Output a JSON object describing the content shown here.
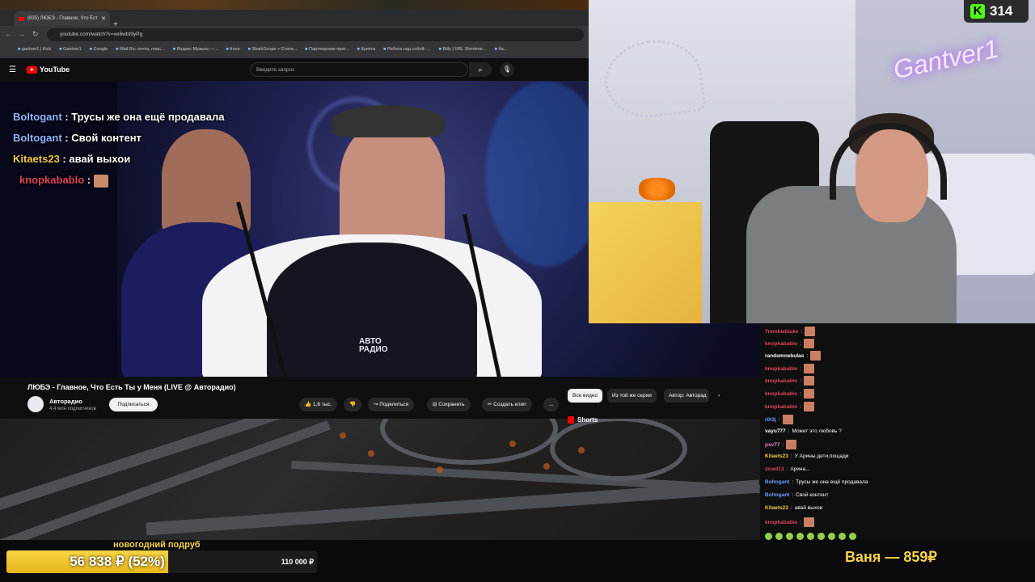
{
  "browser": {
    "tab_title": "(835) ЛЮБЭ - Главное, Что Ест",
    "url": "youtube.com/watch?v=xe6wbt9yPg",
    "bookmarks": [
      "gantver1 | Kick",
      "Gantver1",
      "Google",
      "Mail.Ru: почта, поис...",
      "Яндекс Музыка —...",
      "frovo",
      "SharkScope » Стати...",
      "Партнерские прог...",
      "Крипта",
      "Работа над собой -...",
      "Bitly | URL Shortene...",
      "Ка..."
    ],
    "search_placeholder": "Введите запрос",
    "yt_logo": "YouTube"
  },
  "overlay_chat": [
    {
      "user": "Boltogant",
      "sep": " : ",
      "text": "Трусы же она ещё продавала",
      "color": "blue"
    },
    {
      "user": "Boltogant",
      "sep": " : ",
      "text": "Свой контент",
      "color": "blue"
    },
    {
      "user": "Kitaets23",
      "sep": " : ",
      "text": "авай выхои",
      "color": "yellow"
    },
    {
      "user": "knopkabablo",
      "sep": " : ",
      "text": "",
      "color": "red"
    }
  ],
  "video": {
    "channel_logo_text": "АВТО\nРАДИО",
    "title": "ЛЮБЭ - Главное, Что Есть Ты у Меня (LIVE @ Авторадио)",
    "channel": "Авторадио",
    "subscribers": "4,4 млн подписчиков",
    "subscribe_label": "Подписаться",
    "likes": "1,6 тыс.",
    "share_label": "Поделиться",
    "save_label": "Сохранить",
    "clip_label": "Создать клип",
    "more_label": "...",
    "chips": [
      "Все видео",
      "Из той же серии",
      "Автор: Авторад"
    ],
    "shorts_label": "Shorts"
  },
  "kick": {
    "viewers": "314"
  },
  "webcam": {
    "neon_sign": "Gantver1"
  },
  "side_chat": [
    {
      "user": "Trembleblake",
      "text": "",
      "color": "red",
      "emote": true
    },
    {
      "user": "knopkabablo",
      "text": "",
      "color": "red",
      "emote": true
    },
    {
      "user": "randomnebulas",
      "text": "",
      "color": "white",
      "emote": true
    },
    {
      "user": "knopkabablo",
      "text": "",
      "color": "red",
      "emote": true
    },
    {
      "user": "knopkabablo",
      "text": "",
      "color": "red",
      "emote": true
    },
    {
      "user": "knopkabablo",
      "text": "",
      "color": "red",
      "emote": true
    },
    {
      "user": "knopkabablo",
      "text": "",
      "color": "red",
      "emote": true
    },
    {
      "user": "r0t3j",
      "text": "",
      "color": "blue",
      "emote": true
    },
    {
      "user": "vayu777",
      "text": "Может это любовь ?",
      "color": "white",
      "emote": false
    },
    {
      "user": "psv77",
      "text": "",
      "color": "pink",
      "emote": true
    },
    {
      "user": "Kitaets23",
      "text": "У Арины дети,пощади",
      "color": "yellow",
      "emote": false
    },
    {
      "user": "ziced13",
      "text": "Арина...",
      "color": "red",
      "emote": false
    },
    {
      "user": "Boltogant",
      "text": "Трусы же она ещё продавала",
      "color": "blue",
      "emote": false
    },
    {
      "user": "Boltogant",
      "text": "Свой контент",
      "color": "blue",
      "emote": false
    },
    {
      "user": "Kitaets23",
      "text": "авай выхои",
      "color": "yellow",
      "emote": false
    },
    {
      "user": "knopkabablo",
      "text": "",
      "color": "red",
      "emote": true
    }
  ],
  "donation_goal": {
    "title": "новогодний подруб",
    "current_text": "56 838 ₽ (52%)",
    "target_text": "110 000 ₽",
    "progress_fraction": 0.52,
    "accent": "#f5d24a"
  },
  "top_donor": "Ваня — 859₽"
}
